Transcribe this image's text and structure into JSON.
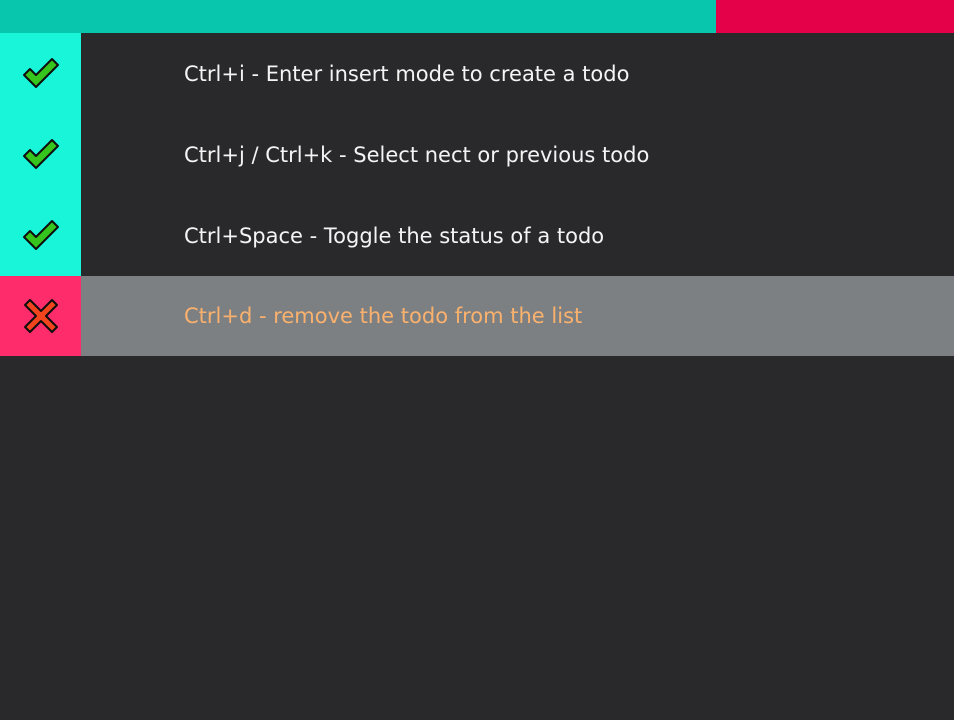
{
  "colors": {
    "background": "#29292b",
    "progress_done": "#08c5ad",
    "progress_remaining": "#e4014a",
    "done_status_bg": "#19f5d9",
    "undone_status_bg": "#ff2c6b",
    "selected_row_bg": "#7d8082",
    "text": "#f4f4f4",
    "selected_text": "#fab16d",
    "check_fill": "#35c51d",
    "cross_fill": "#f2451d",
    "icon_outline": "#0d0d0d"
  },
  "progress": {
    "completed_fraction": 0.75
  },
  "todos": [
    {
      "text": "Ctrl+i - Enter insert mode to create a todo",
      "done": true,
      "selected": false,
      "icon": "check-icon"
    },
    {
      "text": "Ctrl+j / Ctrl+k - Select nect or previous todo",
      "done": true,
      "selected": false,
      "icon": "check-icon"
    },
    {
      "text": "Ctrl+Space - Toggle the status of a todo",
      "done": true,
      "selected": false,
      "icon": "check-icon"
    },
    {
      "text": "Ctrl+d - remove the todo from the list",
      "done": false,
      "selected": true,
      "icon": "cross-icon"
    }
  ]
}
